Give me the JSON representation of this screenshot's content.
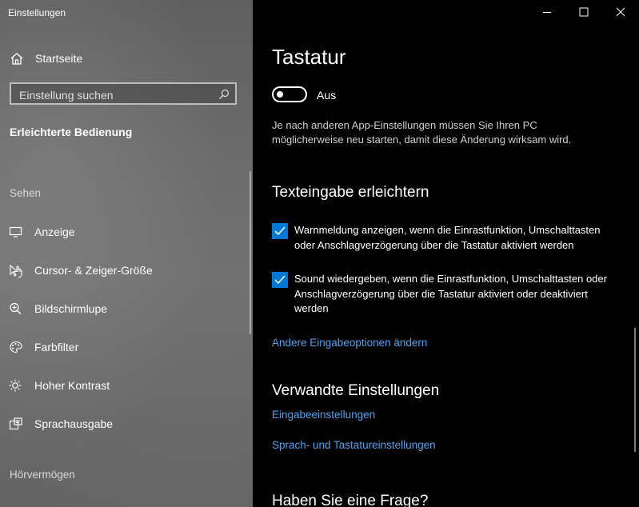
{
  "window": {
    "title": "Einstellungen",
    "controls": {
      "minimize": "minimize-icon",
      "maximize": "maximize-icon",
      "close": "close-icon"
    }
  },
  "sidebar": {
    "home_label": "Startseite",
    "search_placeholder": "Einstellung suchen",
    "category": "Erleichterte Bedienung",
    "sections": [
      {
        "title": "Sehen",
        "items": [
          {
            "label": "Anzeige",
            "icon": "monitor-icon"
          },
          {
            "label": "Cursor- & Zeiger-Größe",
            "icon": "cursor-icon"
          },
          {
            "label": "Bildschirmlupe",
            "icon": "magnifier-icon"
          },
          {
            "label": "Farbfilter",
            "icon": "palette-icon"
          },
          {
            "label": "Hoher Kontrast",
            "icon": "brightness-icon"
          },
          {
            "label": "Sprachausgabe",
            "icon": "narrator-icon"
          }
        ]
      },
      {
        "title": "Hörvermögen"
      }
    ]
  },
  "main": {
    "title": "Tastatur",
    "toggle": {
      "state": "Aus",
      "on": false
    },
    "toggle_description": "Je nach anderen App-Einstellungen müssen Sie Ihren PC möglicherweise neu starten, damit diese Änderung wirksam wird.",
    "section_text_input": {
      "title": "Texteingabe erleichtern",
      "checkboxes": [
        {
          "checked": true,
          "label": "Warnmeldung anzeigen, wenn die Einrastfunktion, Umschalttasten oder Anschlagverzögerung über die Tastatur aktiviert werden"
        },
        {
          "checked": true,
          "label": "Sound wiedergeben, wenn die Einrastfunktion, Umschalttasten oder Anschlagverzögerung über die Tastatur aktiviert oder deaktiviert werden"
        }
      ],
      "link": "Andere Eingabeoptionen ändern"
    },
    "related": {
      "title": "Verwandte Einstellungen",
      "links": [
        "Eingabeeinstellungen",
        "Sprach- und Tastatureinstellungen"
      ]
    },
    "question_title": "Haben Sie eine Frage?"
  },
  "colors": {
    "accent": "#0078d7",
    "link": "#4aa3f0",
    "background": "#000000"
  }
}
